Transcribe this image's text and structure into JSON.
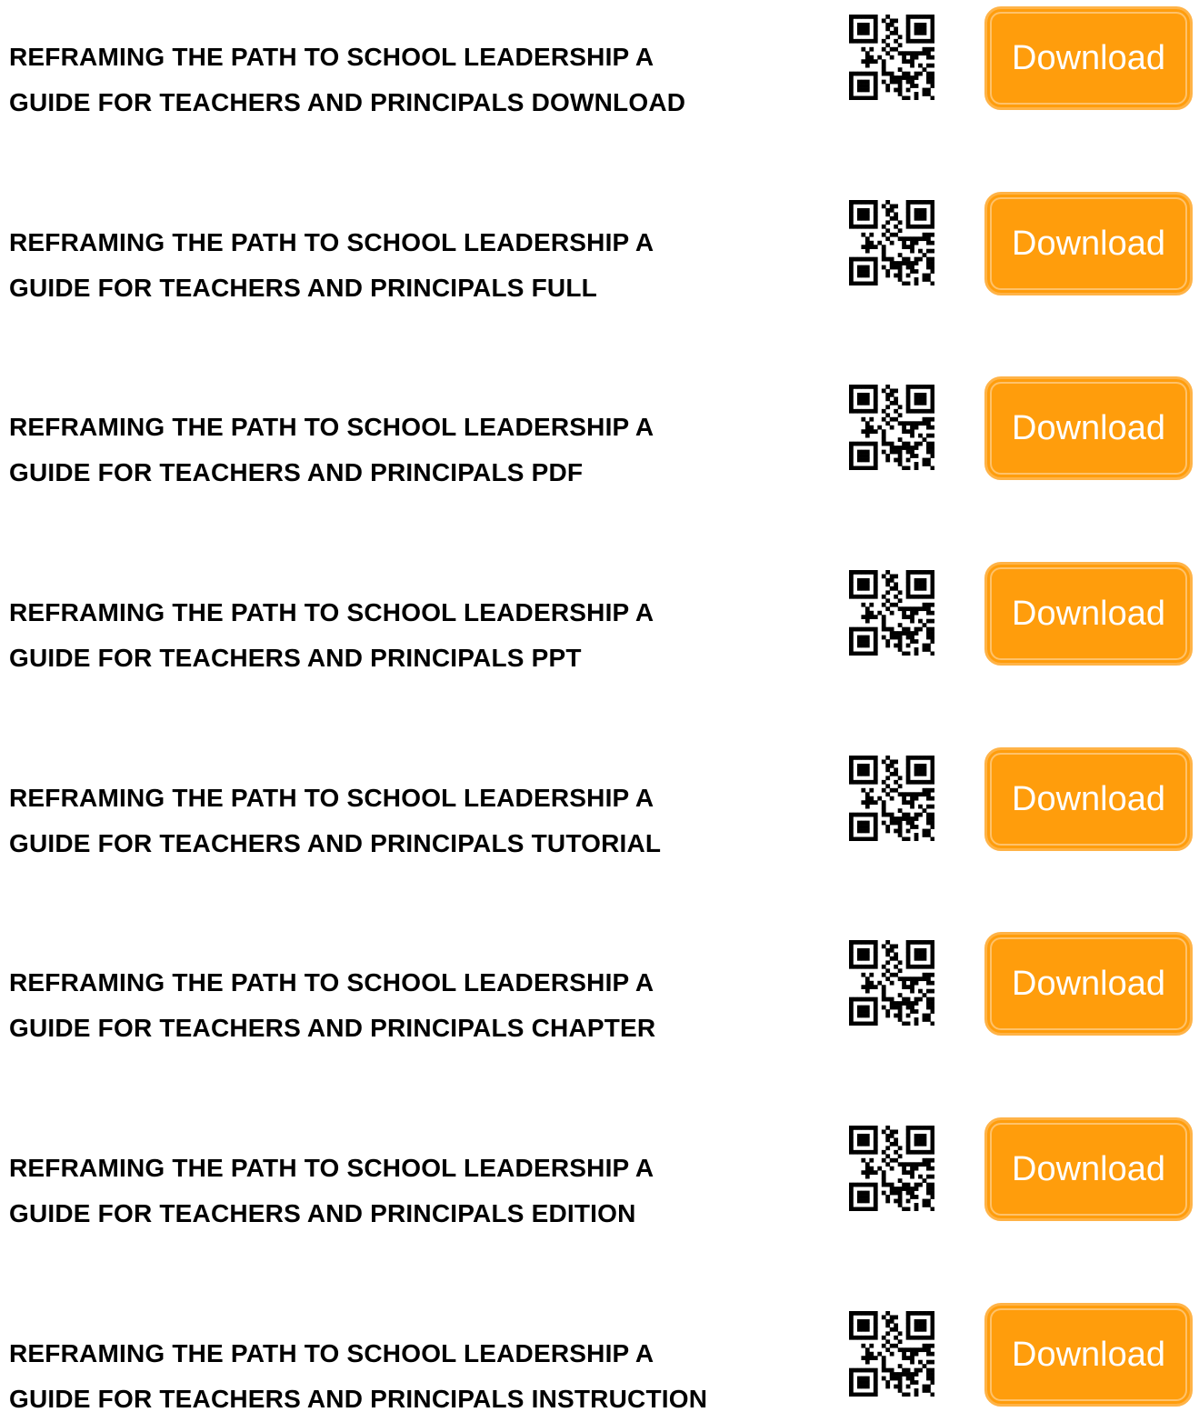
{
  "colors": {
    "button_bg": "#ff9d0c",
    "button_text": "#ffffff",
    "title_text": "#000000"
  },
  "items": [
    {
      "line1": "REFRAMING THE PATH TO SCHOOL LEADERSHIP A",
      "line2": "GUIDE FOR TEACHERS AND PRINCIPALS DOWNLOAD",
      "button_label": "Download",
      "qr_icon": "qr-code-icon"
    },
    {
      "line1": "REFRAMING THE PATH TO SCHOOL LEADERSHIP A",
      "line2": "GUIDE FOR TEACHERS AND PRINCIPALS FULL",
      "button_label": "Download",
      "qr_icon": "qr-code-icon"
    },
    {
      "line1": "REFRAMING THE PATH TO SCHOOL LEADERSHIP A",
      "line2": "GUIDE FOR TEACHERS AND PRINCIPALS PDF",
      "button_label": "Download",
      "qr_icon": "qr-code-icon"
    },
    {
      "line1": "REFRAMING THE PATH TO SCHOOL LEADERSHIP A",
      "line2": "GUIDE FOR TEACHERS AND PRINCIPALS PPT",
      "button_label": "Download",
      "qr_icon": "qr-code-icon"
    },
    {
      "line1": "REFRAMING THE PATH TO SCHOOL LEADERSHIP A",
      "line2": "GUIDE FOR TEACHERS AND PRINCIPALS TUTORIAL",
      "button_label": "Download",
      "qr_icon": "qr-code-icon"
    },
    {
      "line1": "REFRAMING THE PATH TO SCHOOL LEADERSHIP A",
      "line2": "GUIDE FOR TEACHERS AND PRINCIPALS CHAPTER",
      "button_label": "Download",
      "qr_icon": "qr-code-icon"
    },
    {
      "line1": "REFRAMING THE PATH TO SCHOOL LEADERSHIP A",
      "line2": "GUIDE FOR TEACHERS AND PRINCIPALS EDITION",
      "button_label": "Download",
      "qr_icon": "qr-code-icon"
    },
    {
      "line1": "REFRAMING THE PATH TO SCHOOL LEADERSHIP A",
      "line2": "GUIDE FOR TEACHERS AND PRINCIPALS INSTRUCTION",
      "button_label": "Download",
      "qr_icon": "qr-code-icon"
    }
  ]
}
